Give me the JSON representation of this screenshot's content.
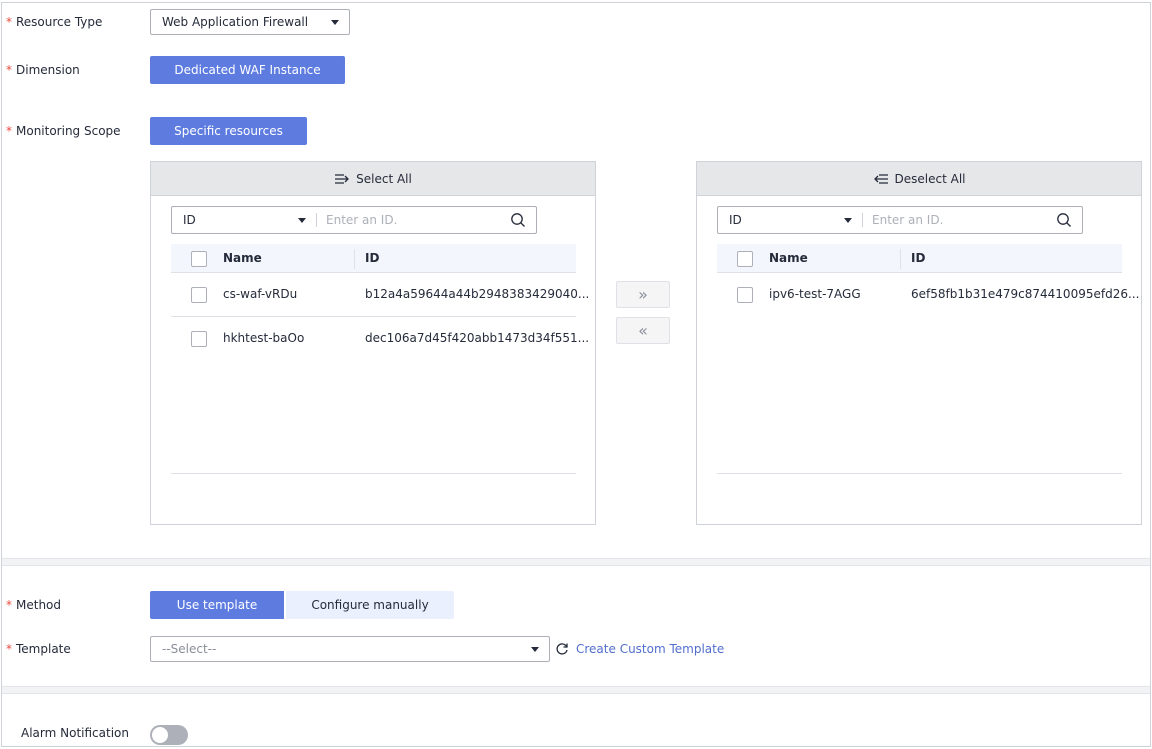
{
  "form": {
    "resource_type": {
      "label": "Resource Type",
      "value": "Web Application Firewall"
    },
    "dimension": {
      "label": "Dimension",
      "value": "Dedicated WAF Instance"
    },
    "monitoring_scope": {
      "label": "Monitoring Scope",
      "value": "Specific resources"
    },
    "method": {
      "label": "Method",
      "options": [
        "Use template",
        "Configure manually"
      ],
      "selected": "Use template"
    },
    "template": {
      "label": "Template",
      "placeholder": "--Select--",
      "create_link": "Create Custom Template"
    },
    "alarm_notification": {
      "label": "Alarm Notification",
      "enabled": false
    }
  },
  "transfer": {
    "left": {
      "header": "Select All",
      "filter_field": "ID",
      "search_placeholder": "Enter an ID.",
      "columns": [
        "Name",
        "ID"
      ],
      "rows": [
        {
          "name": "cs-waf-vRDu",
          "id": "b12a4a59644a44b2948383429040..."
        },
        {
          "name": "hkhtest-baOo",
          "id": "dec106a7d45f420abb1473d34f551..."
        }
      ]
    },
    "right": {
      "header": "Deselect All",
      "filter_field": "ID",
      "search_placeholder": "Enter an ID.",
      "columns": [
        "Name",
        "ID"
      ],
      "rows": [
        {
          "name": "ipv6-test-7AGG",
          "id": "6ef58fb1b31e479c874410095efd26..."
        }
      ]
    },
    "move_right": "»",
    "move_left": "«"
  },
  "colors": {
    "primary": "#5e7ce0",
    "required": "#e84a40",
    "link": "#526ecc"
  }
}
